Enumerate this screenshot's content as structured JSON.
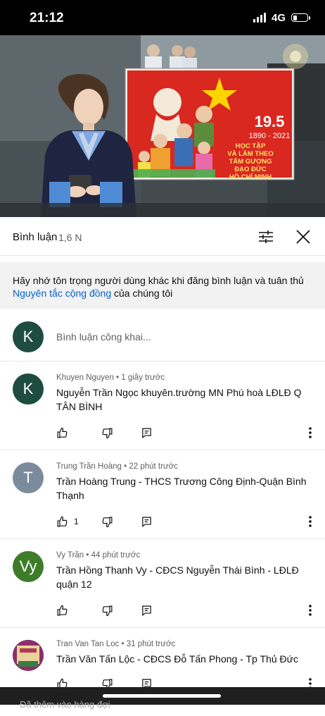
{
  "status_bar": {
    "time": "21:12",
    "network": "4G",
    "battery_level": 0.3
  },
  "video": {
    "poster_badge": "19.5",
    "poster_years": "1890 - 2021",
    "poster_slogan": [
      "HỌC TẬP",
      "VÀ LÀM THEO",
      "TẤM GƯƠNG",
      "ĐẠO ĐỨC",
      "HỒ CHÍ MINH"
    ],
    "progress": 0.07
  },
  "comments_header": {
    "title": "Bình luận",
    "count": "1,6 N"
  },
  "notice": {
    "text_before": "Hãy nhớ tôn trọng người dùng khác khi đăng bình luận và tuân thủ ",
    "link": "Nguyên tắc cộng đồng",
    "text_after": " của chúng tôi"
  },
  "add_comment": {
    "avatar_letter": "K",
    "avatar_color": "#1e4d40",
    "placeholder": "Bình luận công khai..."
  },
  "comments": [
    {
      "author": "Khuyen Nguyen",
      "time": "1 giây trước",
      "text": "Nguyễn Trần Ngọc khuyên.trường MN Phú hoà LĐLĐ Q TÂN BÌNH",
      "likes": "",
      "avatar_letter": "K",
      "avatar_color": "#1e4d40"
    },
    {
      "author": "Trung Trần Hoàng",
      "time": "22 phút trước",
      "text": "Trần Hoàng Trung - THCS Trương Công Định-Quận Bình Thạnh",
      "likes": "1",
      "avatar_letter": "T",
      "avatar_color": "#7b8b9c"
    },
    {
      "author": "Vy Trần",
      "time": "44 phút trước",
      "text": "Trần Hồng Thanh Vy - CĐCS Nguyễn Thái Bình - LĐLĐ quận 12",
      "likes": "",
      "avatar_letter": "Vy",
      "avatar_color": "#3e7c2a"
    },
    {
      "author": "Tran Van Tan Loc",
      "time": "31 phút trước",
      "text": "Trần Văn Tấn Lộc - CĐCS Đỗ Tấn Phong - Tp Thủ Đức",
      "likes": "",
      "avatar_letter": "",
      "avatar_color": "#8a2f6b"
    }
  ],
  "bottom_bar": {
    "text": "Đã thêm vào hàng đợi"
  },
  "colors": {
    "accent": "#065fd4",
    "progress": "#ff0000"
  }
}
